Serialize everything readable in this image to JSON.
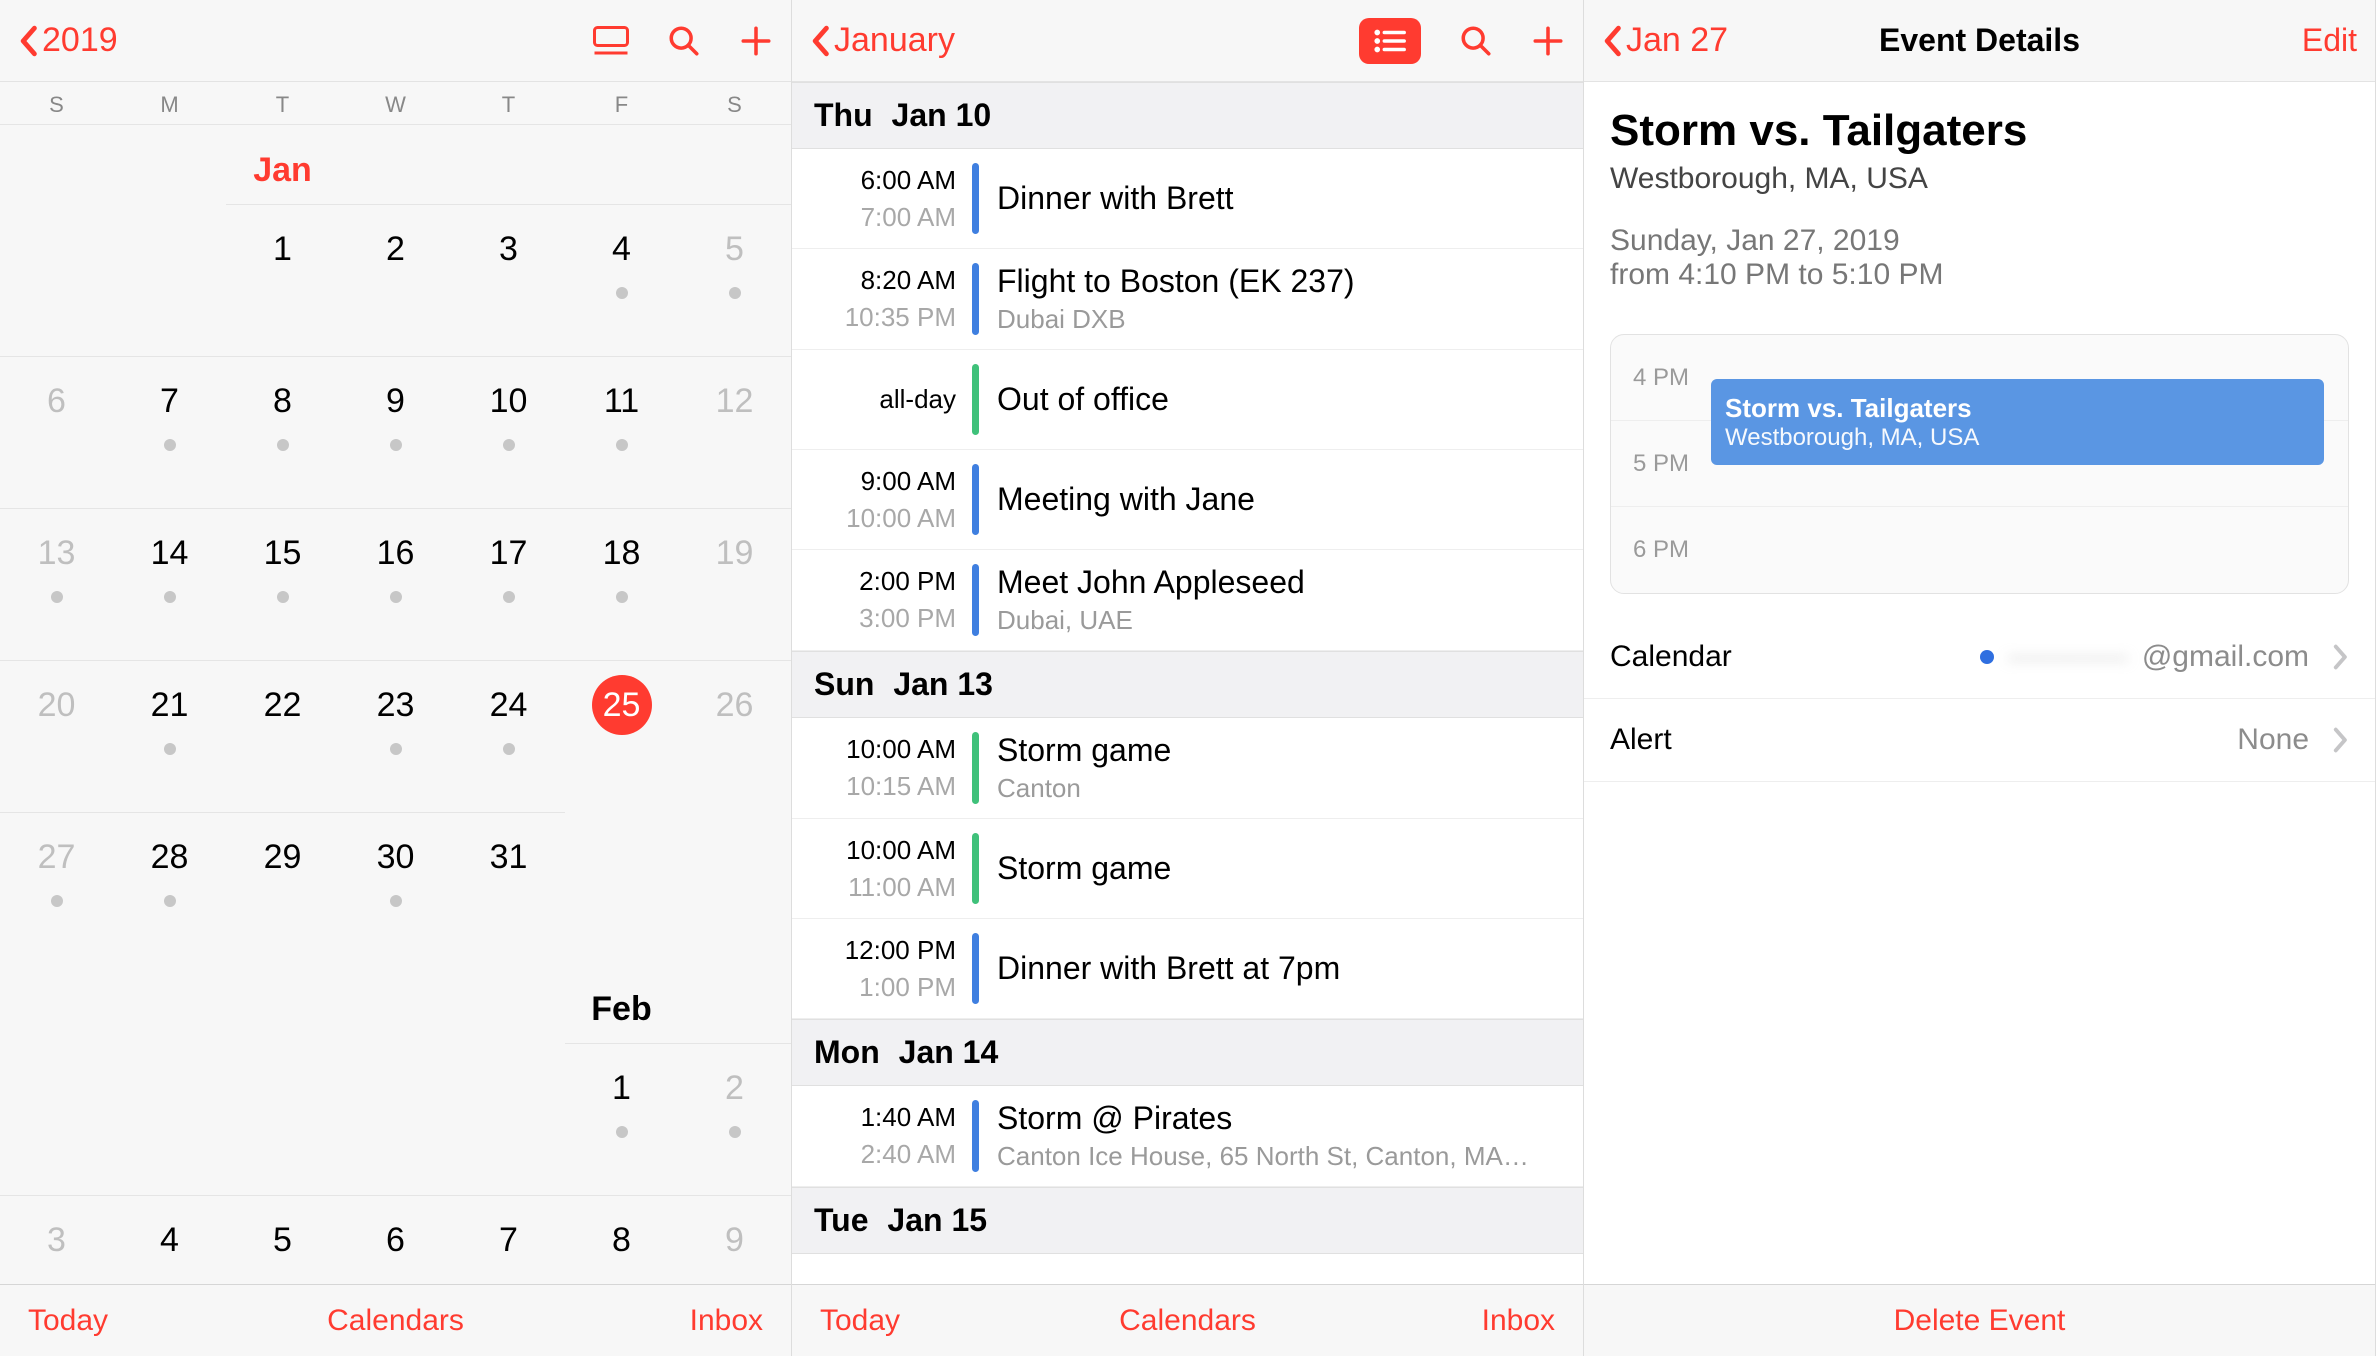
{
  "pane1": {
    "back": "2019",
    "weekdays": [
      "S",
      "M",
      "T",
      "W",
      "T",
      "F",
      "S"
    ],
    "months": [
      {
        "label": "Jan",
        "labelCol": 2,
        "current": true,
        "weeks": [
          [
            null,
            null,
            {
              "n": "1"
            },
            {
              "n": "2"
            },
            {
              "n": "3"
            },
            {
              "n": "4",
              "dot": true
            },
            {
              "n": "5",
              "out": true,
              "dot": true
            }
          ],
          [
            {
              "n": "6",
              "out": true
            },
            {
              "n": "7",
              "dot": true
            },
            {
              "n": "8",
              "dot": true
            },
            {
              "n": "9",
              "dot": true
            },
            {
              "n": "10",
              "dot": true
            },
            {
              "n": "11",
              "dot": true
            },
            {
              "n": "12",
              "out": true
            }
          ],
          [
            {
              "n": "13",
              "out": true,
              "dot": true
            },
            {
              "n": "14",
              "dot": true
            },
            {
              "n": "15",
              "dot": true
            },
            {
              "n": "16",
              "dot": true
            },
            {
              "n": "17",
              "dot": true
            },
            {
              "n": "18",
              "dot": true
            },
            {
              "n": "19",
              "out": true
            }
          ],
          [
            {
              "n": "20",
              "out": true
            },
            {
              "n": "21",
              "dot": true
            },
            {
              "n": "22"
            },
            {
              "n": "23",
              "dot": true
            },
            {
              "n": "24",
              "dot": true
            },
            {
              "n": "25",
              "today": true
            },
            {
              "n": "26",
              "out": true
            }
          ],
          [
            {
              "n": "27",
              "out": true,
              "dot": true
            },
            {
              "n": "28",
              "dot": true
            },
            {
              "n": "29"
            },
            {
              "n": "30",
              "dot": true
            },
            {
              "n": "31"
            },
            null,
            null
          ]
        ]
      },
      {
        "label": "Feb",
        "labelCol": 5,
        "current": false,
        "weeks": [
          [
            null,
            null,
            null,
            null,
            null,
            {
              "n": "1",
              "dot": true
            },
            {
              "n": "2",
              "out": true,
              "dot": true
            }
          ],
          [
            {
              "n": "3",
              "out": true
            },
            {
              "n": "4"
            },
            {
              "n": "5"
            },
            {
              "n": "6"
            },
            {
              "n": "7"
            },
            {
              "n": "8"
            },
            {
              "n": "9",
              "out": true
            }
          ]
        ]
      }
    ],
    "toolbar": {
      "left": "Today",
      "center": "Calendars",
      "right": "Inbox"
    }
  },
  "pane2": {
    "back": "January",
    "days": [
      {
        "dow": "Thu",
        "date": "Jan 10",
        "events": [
          {
            "start": "6:00 AM",
            "end": "7:00 AM",
            "color": "blue",
            "title": "Dinner with Brett"
          },
          {
            "start": "8:20 AM",
            "end": "10:35 PM",
            "color": "blue",
            "title": "Flight to Boston (EK 237)",
            "loc": "Dubai DXB"
          },
          {
            "start": "all-day",
            "end": "",
            "color": "green",
            "title": "Out of office"
          },
          {
            "start": "9:00 AM",
            "end": "10:00 AM",
            "color": "blue",
            "title": "Meeting with Jane"
          },
          {
            "start": "2:00 PM",
            "end": "3:00 PM",
            "color": "blue",
            "title": "Meet John Appleseed",
            "loc": "Dubai, UAE"
          }
        ]
      },
      {
        "dow": "Sun",
        "date": "Jan 13",
        "events": [
          {
            "start": "10:00 AM",
            "end": "10:15 AM",
            "color": "green",
            "title": "Storm game",
            "loc": "Canton"
          },
          {
            "start": "10:00 AM",
            "end": "11:00 AM",
            "color": "green",
            "title": "Storm game"
          },
          {
            "start": "12:00 PM",
            "end": "1:00 PM",
            "color": "blue",
            "title": "Dinner with Brett at 7pm"
          }
        ]
      },
      {
        "dow": "Mon",
        "date": "Jan 14",
        "events": [
          {
            "start": "1:40 AM",
            "end": "2:40 AM",
            "color": "blue",
            "title": "Storm @ Pirates",
            "loc": "Canton Ice House, 65 North St, Canton, MA…"
          }
        ]
      },
      {
        "dow": "Tue",
        "date": "Jan 15",
        "events": []
      }
    ],
    "toolbar": {
      "left": "Today",
      "center": "Calendars",
      "right": "Inbox"
    }
  },
  "pane3": {
    "back": "Jan 27",
    "title": "Event Details",
    "edit": "Edit",
    "event": {
      "title": "Storm vs. Tailgaters",
      "location": "Westborough, MA, USA",
      "dateLine": "Sunday, Jan 27, 2019",
      "timeLine": "from 4:10 PM to 5:10 PM"
    },
    "timeline": {
      "hours": [
        "4 PM",
        "5 PM",
        "6 PM"
      ],
      "block": {
        "title": "Storm vs. Tailgaters",
        "loc": "Westborough, MA, USA"
      }
    },
    "rows": {
      "calendar": {
        "label": "Calendar",
        "account_hidden": "————",
        "domain": "@gmail.com"
      },
      "alert": {
        "label": "Alert",
        "value": "None"
      }
    },
    "delete": "Delete Event"
  }
}
